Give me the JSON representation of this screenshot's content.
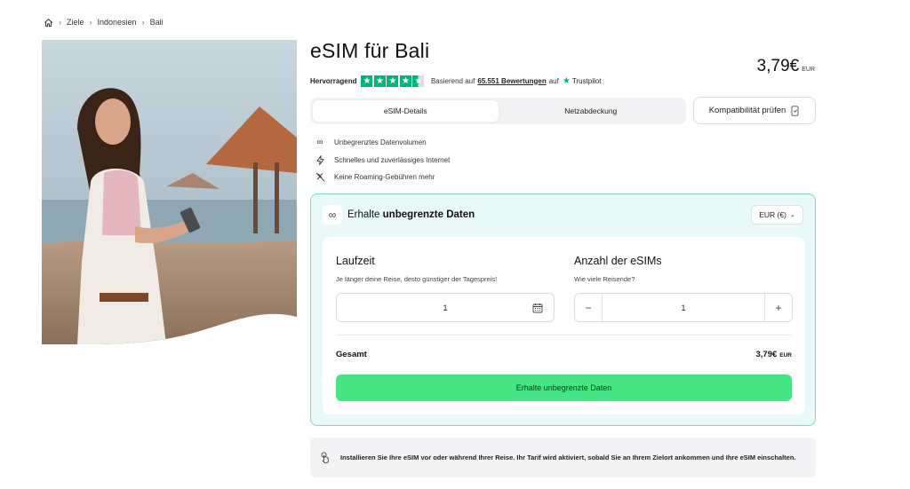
{
  "breadcrumb": {
    "home_icon": "home-icon",
    "items": [
      "Ziele",
      "Indonesien",
      "Bali"
    ]
  },
  "product": {
    "title": "eSIM für Bali",
    "price": "3,79€",
    "currency": "EUR"
  },
  "rating": {
    "label": "Hervorragend",
    "stars": 4.5,
    "prefix": "Basierend auf",
    "count": "65.551 Bewertungen",
    "suffix": "auf",
    "provider": "Trustpilot",
    "color": "#00b67a"
  },
  "tabs": [
    {
      "label": "eSIM-Details",
      "active": true
    },
    {
      "label": "Netzabdeckung",
      "active": false
    }
  ],
  "compat_button": {
    "label": "Kompatibilität prüfen",
    "icon": "phone-check-icon"
  },
  "features": [
    {
      "icon": "infinity-icon",
      "label": "Unbegrenztes Datenvolumen"
    },
    {
      "icon": "lightning-icon",
      "label": "Schnelles und zuverlässiges Internet"
    },
    {
      "icon": "no-roaming-icon",
      "label": "Keine Roaming-Gebühren mehr"
    }
  ],
  "card": {
    "head_prefix": "Erhalte",
    "head_bold": "unbegrenzte Daten",
    "currency_select": "EUR (€)",
    "duration": {
      "title": "Laufzeit",
      "subtitle": "Je länger deine Reise, desto günstiger der Tagespreis!",
      "value": "1"
    },
    "esims": {
      "title": "Anzahl der eSIMs",
      "subtitle": "Wie viele Reisende?",
      "value": "1",
      "minus": "−",
      "plus": "+"
    },
    "total_label": "Gesamt",
    "total_value": "3,79€",
    "total_currency": "EUR",
    "cta": "Erhalte unbegrenzte Daten",
    "accent_color": "#47e483",
    "border_color": "#7cdfb9",
    "background": "#e9f8f9"
  },
  "note": {
    "icon": "tap-hand-icon",
    "text": "Installieren Sie Ihre eSIM vor oder während Ihrer Reise. Ihr Tarif wird aktiviert, sobald Sie an Ihrem Zielort ankommen und Ihre eSIM einschalten."
  }
}
